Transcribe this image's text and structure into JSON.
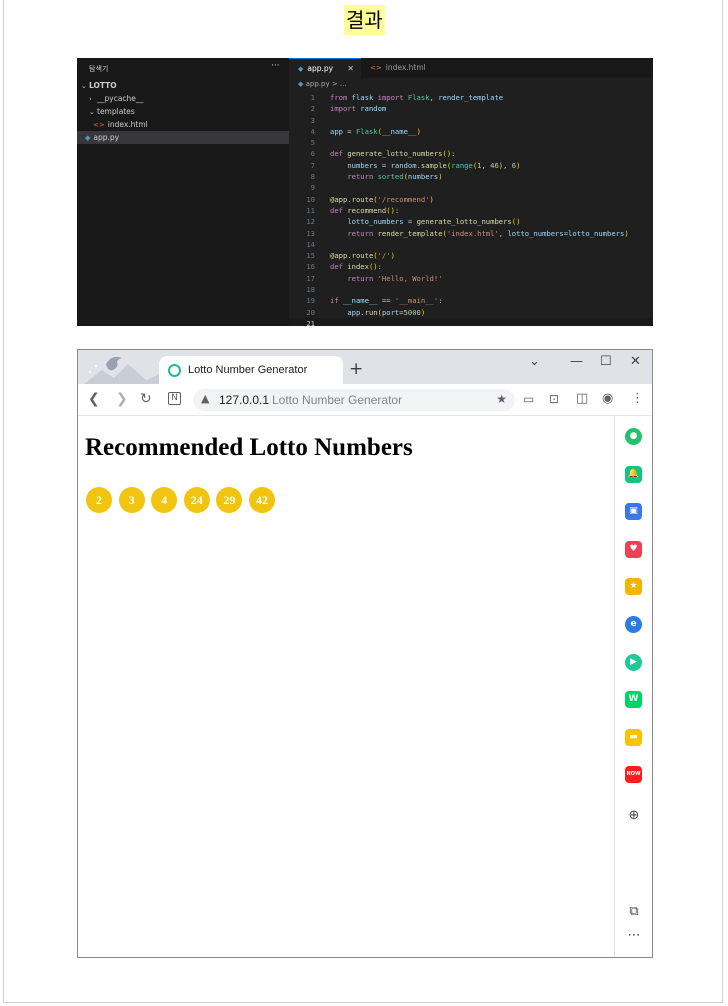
{
  "heading": "결과",
  "vscode": {
    "explorer_title": "탐색기",
    "explorer_more": "···",
    "tree": [
      {
        "label": "LOTTO",
        "type": "root"
      },
      {
        "label": "__pycache__",
        "type": "folder"
      },
      {
        "label": "templates",
        "type": "folder-open"
      },
      {
        "label": "index.html",
        "type": "html"
      },
      {
        "label": "app.py",
        "type": "py",
        "selected": true
      }
    ],
    "tabs": [
      {
        "label": "app.py",
        "active": true,
        "close": "✕"
      },
      {
        "label": "index.html",
        "active": false
      }
    ],
    "breadcrumb": "app.py > ...",
    "code_lines": [
      "from flask import Flask, render_template",
      "import random",
      "",
      "app = Flask(__name__)",
      "",
      "def generate_lotto_numbers():",
      "    numbers = random.sample(range(1, 46), 6)",
      "    return sorted(numbers)",
      "",
      "@app.route('/recommend')",
      "def recommend():",
      "    lotto_numbers = generate_lotto_numbers()",
      "    return render_template('index.html', lotto_numbers=lotto_numbers)",
      "",
      "@app.route('/')",
      "def index():",
      "    return 'Hello, World!'",
      "",
      "if __name__ == '__main__':",
      "    app.run(port=5000)",
      ""
    ]
  },
  "browser": {
    "tab_title": "Lotto Number Generator",
    "new_tab": "+",
    "address_host": "127.0.0.1",
    "address_title": "Lotto Number Generator",
    "page_heading": "Recommended Lotto Numbers",
    "numbers": [
      "2",
      "3",
      "4",
      "24",
      "29",
      "42"
    ],
    "ball_color": "#f1c40f",
    "sidebar_apps": [
      {
        "name": "circle-app-icon",
        "color": "#1ec36b",
        "glyph": "●"
      },
      {
        "name": "bell-app-icon",
        "color": "#14c37f",
        "glyph": "🔔"
      },
      {
        "name": "briefcase-app-icon",
        "color": "#3b78e7",
        "glyph": "▣"
      },
      {
        "name": "pocket-app-icon",
        "color": "#ef4056",
        "glyph": "♥"
      },
      {
        "name": "star-app-icon",
        "color": "#f5b400",
        "glyph": "★"
      },
      {
        "name": "edge-app-icon",
        "color": "#2a7de1",
        "glyph": "e"
      },
      {
        "name": "play-app-icon",
        "color": "#20c997",
        "glyph": "▶"
      },
      {
        "name": "webtoon-app-icon",
        "color": "#00d564",
        "glyph": "W"
      },
      {
        "name": "notes-app-icon",
        "color": "#f7c200",
        "glyph": "▬"
      },
      {
        "name": "now-app-icon",
        "color": "#ff1e1e",
        "glyph": "NOW"
      }
    ]
  }
}
